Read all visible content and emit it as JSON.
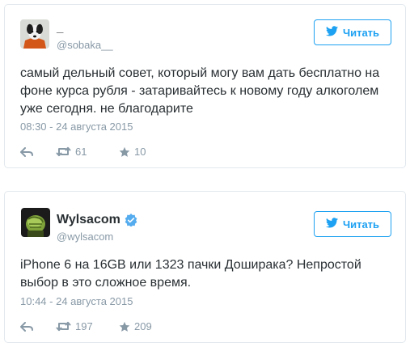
{
  "colors": {
    "accent": "#1da1f2",
    "text": "#292f33",
    "muted": "#8899a6",
    "border": "#e1e8ed",
    "verified": "#55acee"
  },
  "tweets": [
    {
      "display_name": "_",
      "handle": "@sobaka__",
      "verified": false,
      "follow_label": "Читать",
      "text": "самый дельный совет, который могу вам дать бесплатно на фоне курса рубля - затаривайтесь к новому году алкоголем уже сегодня. не благодарите",
      "timestamp": "08:30 - 24 августа 2015",
      "retweets": "61",
      "likes": "10",
      "icons": [
        "reply-icon",
        "retweet-icon",
        "star-icon",
        "twitter-bird-icon"
      ]
    },
    {
      "display_name": "Wylsacom",
      "handle": "@wylsacom",
      "verified": true,
      "follow_label": "Читать",
      "text": "iPhone 6 на 16GB или 1323 пачки Доширака? Непростой выбор в это сложное время.",
      "timestamp": "10:44 - 24 августа 2015",
      "retweets": "197",
      "likes": "209",
      "icons": [
        "reply-icon",
        "retweet-icon",
        "star-icon",
        "twitter-bird-icon",
        "verified-badge-icon"
      ]
    }
  ]
}
